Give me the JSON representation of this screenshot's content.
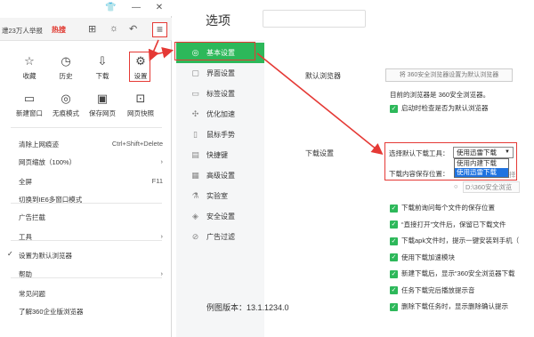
{
  "browser_menu": {
    "toolbar_icons": [
      "shirt-icon",
      "minimize-icon",
      "close-icon"
    ],
    "news_text": "遭23万人举报",
    "hot_text": "热搜",
    "grid_top": [
      {
        "icon": "star-icon",
        "glyph": "☆",
        "label": "收藏"
      },
      {
        "icon": "clock-icon",
        "glyph": "◷",
        "label": "历史"
      },
      {
        "icon": "download-icon",
        "glyph": "⇩",
        "label": "下载"
      },
      {
        "icon": "gear-icon",
        "glyph": "⚙",
        "label": "设置"
      }
    ],
    "grid_bottom": [
      {
        "icon": "new-window-icon",
        "glyph": "▭",
        "label": "新建窗口"
      },
      {
        "icon": "incognito-icon",
        "glyph": "◎",
        "label": "无痕模式"
      },
      {
        "icon": "save-icon",
        "glyph": "▣",
        "label": "保存网页"
      },
      {
        "icon": "screenshot-icon",
        "glyph": "⊡",
        "label": "网页快照"
      }
    ],
    "items": [
      {
        "label": "清除上网痕迹",
        "shortcut": "Ctrl+Shift+Delete",
        "arrow": "",
        "check": ""
      },
      {
        "label": "网页缩放（100%）",
        "shortcut": "",
        "arrow": "›",
        "check": ""
      },
      {
        "label": "全屏",
        "shortcut": "F11",
        "arrow": "",
        "check": ""
      },
      {
        "label": "切换到IE6多窗口模式",
        "shortcut": "",
        "arrow": "",
        "check": ""
      },
      {
        "label": "广告拦截",
        "shortcut": "",
        "arrow": "",
        "check": ""
      },
      {
        "label": "工具",
        "shortcut": "",
        "arrow": "›",
        "check": ""
      },
      {
        "label": "设置为默认浏览器",
        "shortcut": "",
        "arrow": "",
        "check": "✓"
      },
      {
        "label": "帮助",
        "shortcut": "",
        "arrow": "›",
        "check": ""
      },
      {
        "label": "常见问题",
        "shortcut": "",
        "arrow": "",
        "check": ""
      },
      {
        "label": "了解360企业版浏览器",
        "shortcut": "",
        "arrow": "",
        "check": ""
      }
    ]
  },
  "settings": {
    "title": "选项",
    "sidebar": [
      {
        "icon": "settings-circle-icon",
        "glyph": "◎",
        "label": "基本设置",
        "active": true
      },
      {
        "icon": "interface-icon",
        "glyph": "▢",
        "label": "界面设置"
      },
      {
        "icon": "tab-icon",
        "glyph": "▭",
        "label": "标签设置"
      },
      {
        "icon": "accelerate-icon",
        "glyph": "✣",
        "label": "优化加速"
      },
      {
        "icon": "mouse-icon",
        "glyph": "▯",
        "label": "鼠标手势"
      },
      {
        "icon": "keyboard-icon",
        "glyph": "▤",
        "label": "快捷键"
      },
      {
        "icon": "advanced-icon",
        "glyph": "▦",
        "label": "高级设置"
      },
      {
        "icon": "lab-icon",
        "glyph": "⚗",
        "label": "实验室"
      },
      {
        "icon": "shield-icon",
        "glyph": "◈",
        "label": "安全设置"
      },
      {
        "icon": "ad-filter-icon",
        "glyph": "⊘",
        "label": "广告过滤"
      }
    ],
    "version": "例图版本：13.1.1234.0",
    "default_browser": {
      "section": "默认浏览器",
      "button": "将 360安全浏览器设置为默认浏览器",
      "status": "目前的浏览器是 360安全浏览器。",
      "check_label": "启动时检查是否为默认浏览器"
    },
    "download": {
      "section": "下载设置",
      "tool_label": "选择默认下载工具：",
      "tool_value": "使用迅雷下载",
      "options": [
        "使用内建下载",
        "使用迅雷下载"
      ],
      "selected_index": 1,
      "path_label": "下载内容保存位置：",
      "path_value": "D:\\360安全浏览",
      "checks": [
        "下载前询问每个文件的保存位置",
        "“直接打开”文件后，保留已下载文件",
        "下载apk文件时，提示一键安装到手机（",
        "使用下载加速模块",
        "新建下载后，显示“360安全浏览器下载",
        "任务下载完后播放提示音",
        "删除下载任务时，显示删除确认提示"
      ]
    }
  }
}
